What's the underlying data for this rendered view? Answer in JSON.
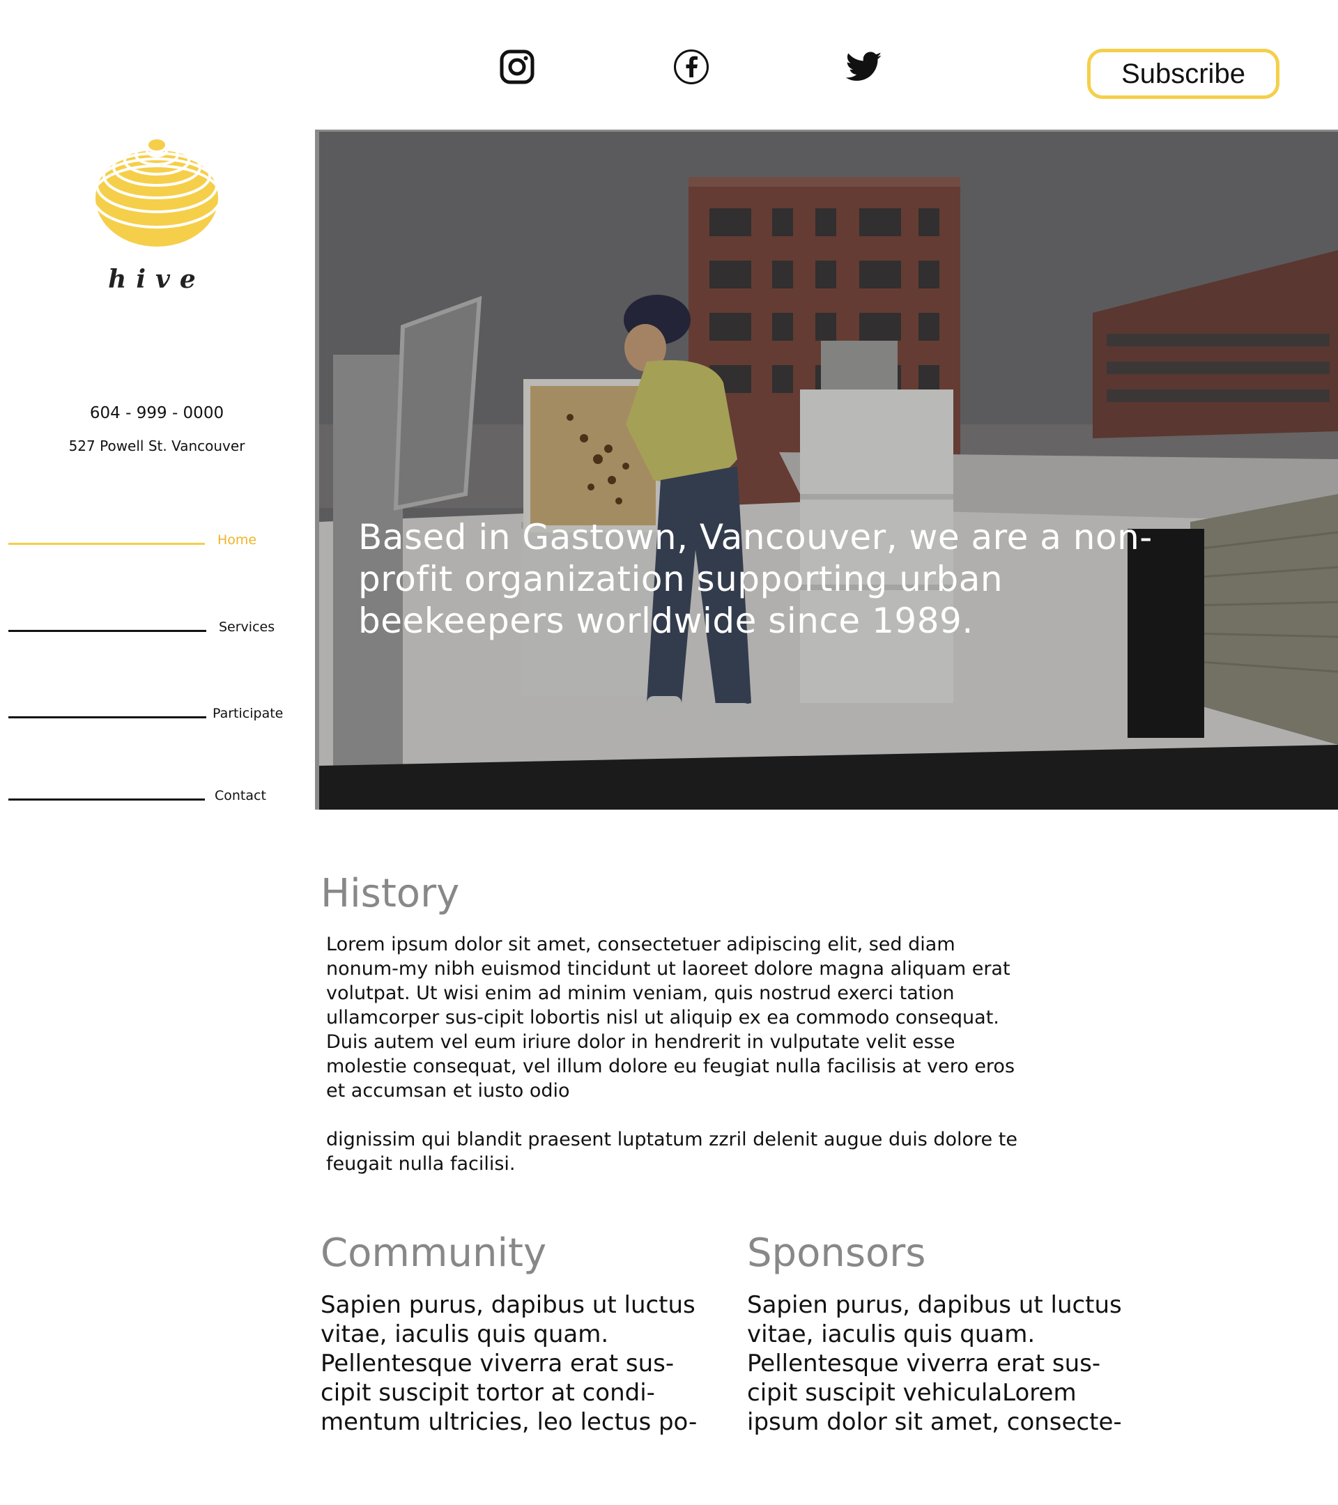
{
  "header": {
    "social": {
      "instagram_icon": "instagram-icon",
      "facebook_icon": "facebook-icon",
      "twitter_icon": "twitter-icon"
    },
    "subscribe_label": "Subscribe"
  },
  "brand": {
    "name": "hive",
    "logo_icon": "beehive-logo",
    "accent_color": "#f5cf4a"
  },
  "contact": {
    "phone": "604 - 999 - 0000",
    "address": "527 Powell St. Vancouver"
  },
  "nav": {
    "items": [
      {
        "label": "Home",
        "active": true
      },
      {
        "label": "Services",
        "active": false
      },
      {
        "label": "Participate",
        "active": false
      },
      {
        "label": "Contact",
        "active": false
      }
    ]
  },
  "hero": {
    "text": "Based in Gastown, Vancouver, we are a non-profit organization supporting urban beekeepers worldwide since 1989."
  },
  "history": {
    "title": "History",
    "paragraph1": "Lorem ipsum dolor sit amet, consectetuer adipiscing elit, sed diam nonum-my nibh euismod tincidunt ut laoreet dolore magna aliquam erat volutpat. Ut wisi enim ad minim veniam, quis nostrud exerci tation ullamcorper sus-cipit lobortis nisl ut aliquip ex ea commodo consequat. Duis autem vel eum iriure dolor in hendrerit in vulputate velit esse molestie consequat, vel illum dolore eu feugiat nulla facilisis at vero eros et accumsan et iusto odio",
    "paragraph2": "dignissim qui blandit praesent luptatum zzril delenit augue duis dolore te feugait nulla facilisi."
  },
  "community": {
    "title": "Community",
    "body": "Sapien purus, dapibus ut luctus vitae, iaculis quis quam. Pellentesque viverra erat sus-cipit suscipit tortor at condi-mentum ultricies, leo lectus po-"
  },
  "sponsors": {
    "title": "Sponsors",
    "body": "Sapien purus, dapibus ut luctus vitae, iaculis quis quam. Pellentesque viverra erat sus-cipit suscipit vehiculaLorem ipsum dolor sit amet, consecte-"
  }
}
